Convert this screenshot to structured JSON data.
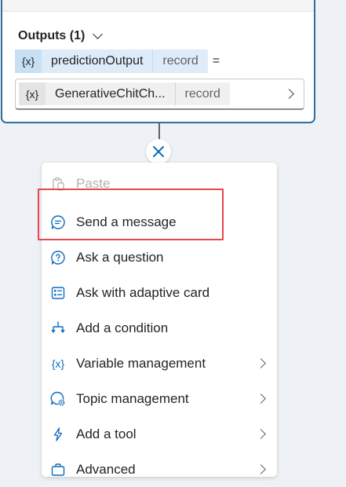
{
  "node": {
    "outputs_label": "Outputs (1)",
    "variable_icon": "{x}",
    "variable_name": "predictionOutput",
    "variable_type": "record",
    "equals": "=",
    "value": {
      "icon": "{x}",
      "name": "GenerativeChitCh...",
      "type": "record"
    }
  },
  "menu": {
    "items": [
      {
        "label": "Paste",
        "icon": "clipboard-icon",
        "disabled": true
      },
      {
        "label": "Send a message",
        "icon": "chat-bubble-icon",
        "highlighted": true
      },
      {
        "label": "Ask a question",
        "icon": "question-bubble-icon"
      },
      {
        "label": "Ask with adaptive card",
        "icon": "adaptive-card-icon"
      },
      {
        "label": "Add a condition",
        "icon": "branch-icon"
      },
      {
        "label": "Variable management",
        "icon": "variable-icon",
        "icon_text": "{x}",
        "submenu": true
      },
      {
        "label": "Topic management",
        "icon": "topic-gear-icon",
        "submenu": true
      },
      {
        "label": "Add a tool",
        "icon": "lightning-icon",
        "submenu": true
      },
      {
        "label": "Advanced",
        "icon": "briefcase-icon",
        "submenu": true
      }
    ]
  },
  "colors": {
    "accent": "#0f6cbd",
    "node_border": "#2f6f9a",
    "highlight": "#e5484d",
    "canvas": "#eef1f5"
  }
}
